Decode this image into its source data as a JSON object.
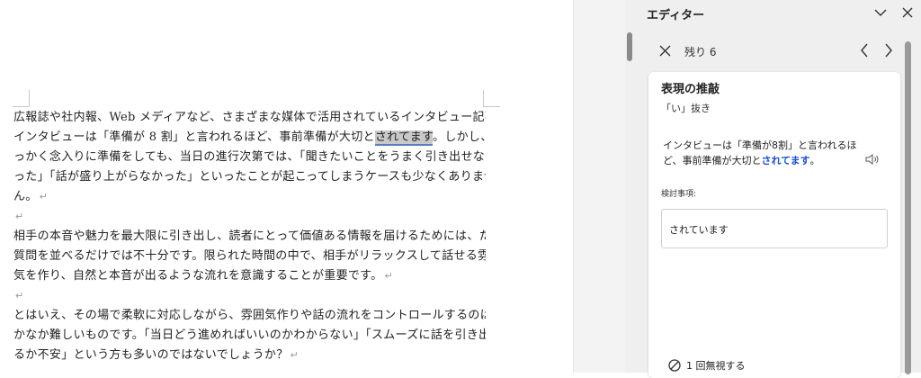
{
  "document": {
    "paragraphs": [
      {
        "lines": [
          "広報誌や社内報、Web メディアなど、さまざまな媒体で活用されているインタビュー記事。",
          {
            "before": "インタビューは「準備が 8 割」と言われるほど、事前準備が大切と",
            "highlight": "されてます",
            "after": "。しかし、せ"
          },
          "っかく念入りに準備をしても、当日の進行次第では、「聞きたいことをうまく引き出せなか",
          "った」「話が盛り上がらなかった」といったことが起こってしまうケースも少なくありませ",
          "ん。"
        ]
      },
      {
        "lines": [
          "相手の本音や魅力を最大限に引き出し、読者にとって価値ある情報を届けるためには、ただ",
          "質問を並べるだけでは不十分です。限られた時間の中で、相手がリラックスして話せる雰囲",
          "気を作り、自然と本音が出るような流れを意識することが重要です。"
        ]
      },
      {
        "lines": [
          "とはいえ、その場で柔軟に対応しながら、雰囲気作りや話の流れをコントロールするのはな",
          "かなか難しいものです。「当日どう進めればいいのかわからない」「スムーズに話を引き出せ",
          "るか不安」という方も多いのではないでしょうか？"
        ]
      }
    ],
    "paragraph_mark": "↵"
  },
  "pane": {
    "title": "エディター",
    "collapse_icon": "chevron-down-icon",
    "close_icon": "close-icon",
    "nav": {
      "close_icon": "close-icon",
      "remaining": "残り 6",
      "prev_icon": "chevron-left-icon",
      "next_icon": "chevron-right-icon"
    },
    "card": {
      "heading": "表現の推敲",
      "subheading": "「い」抜き",
      "sentence_before": "インタビューは「準備が8割」と言われるほど、事前準備が大切と",
      "sentence_emphasis": "されてます",
      "sentence_after": "。",
      "consider_label": "検討事項:",
      "suggestion": "されています",
      "ignore_label": "1 回無視する"
    }
  }
}
